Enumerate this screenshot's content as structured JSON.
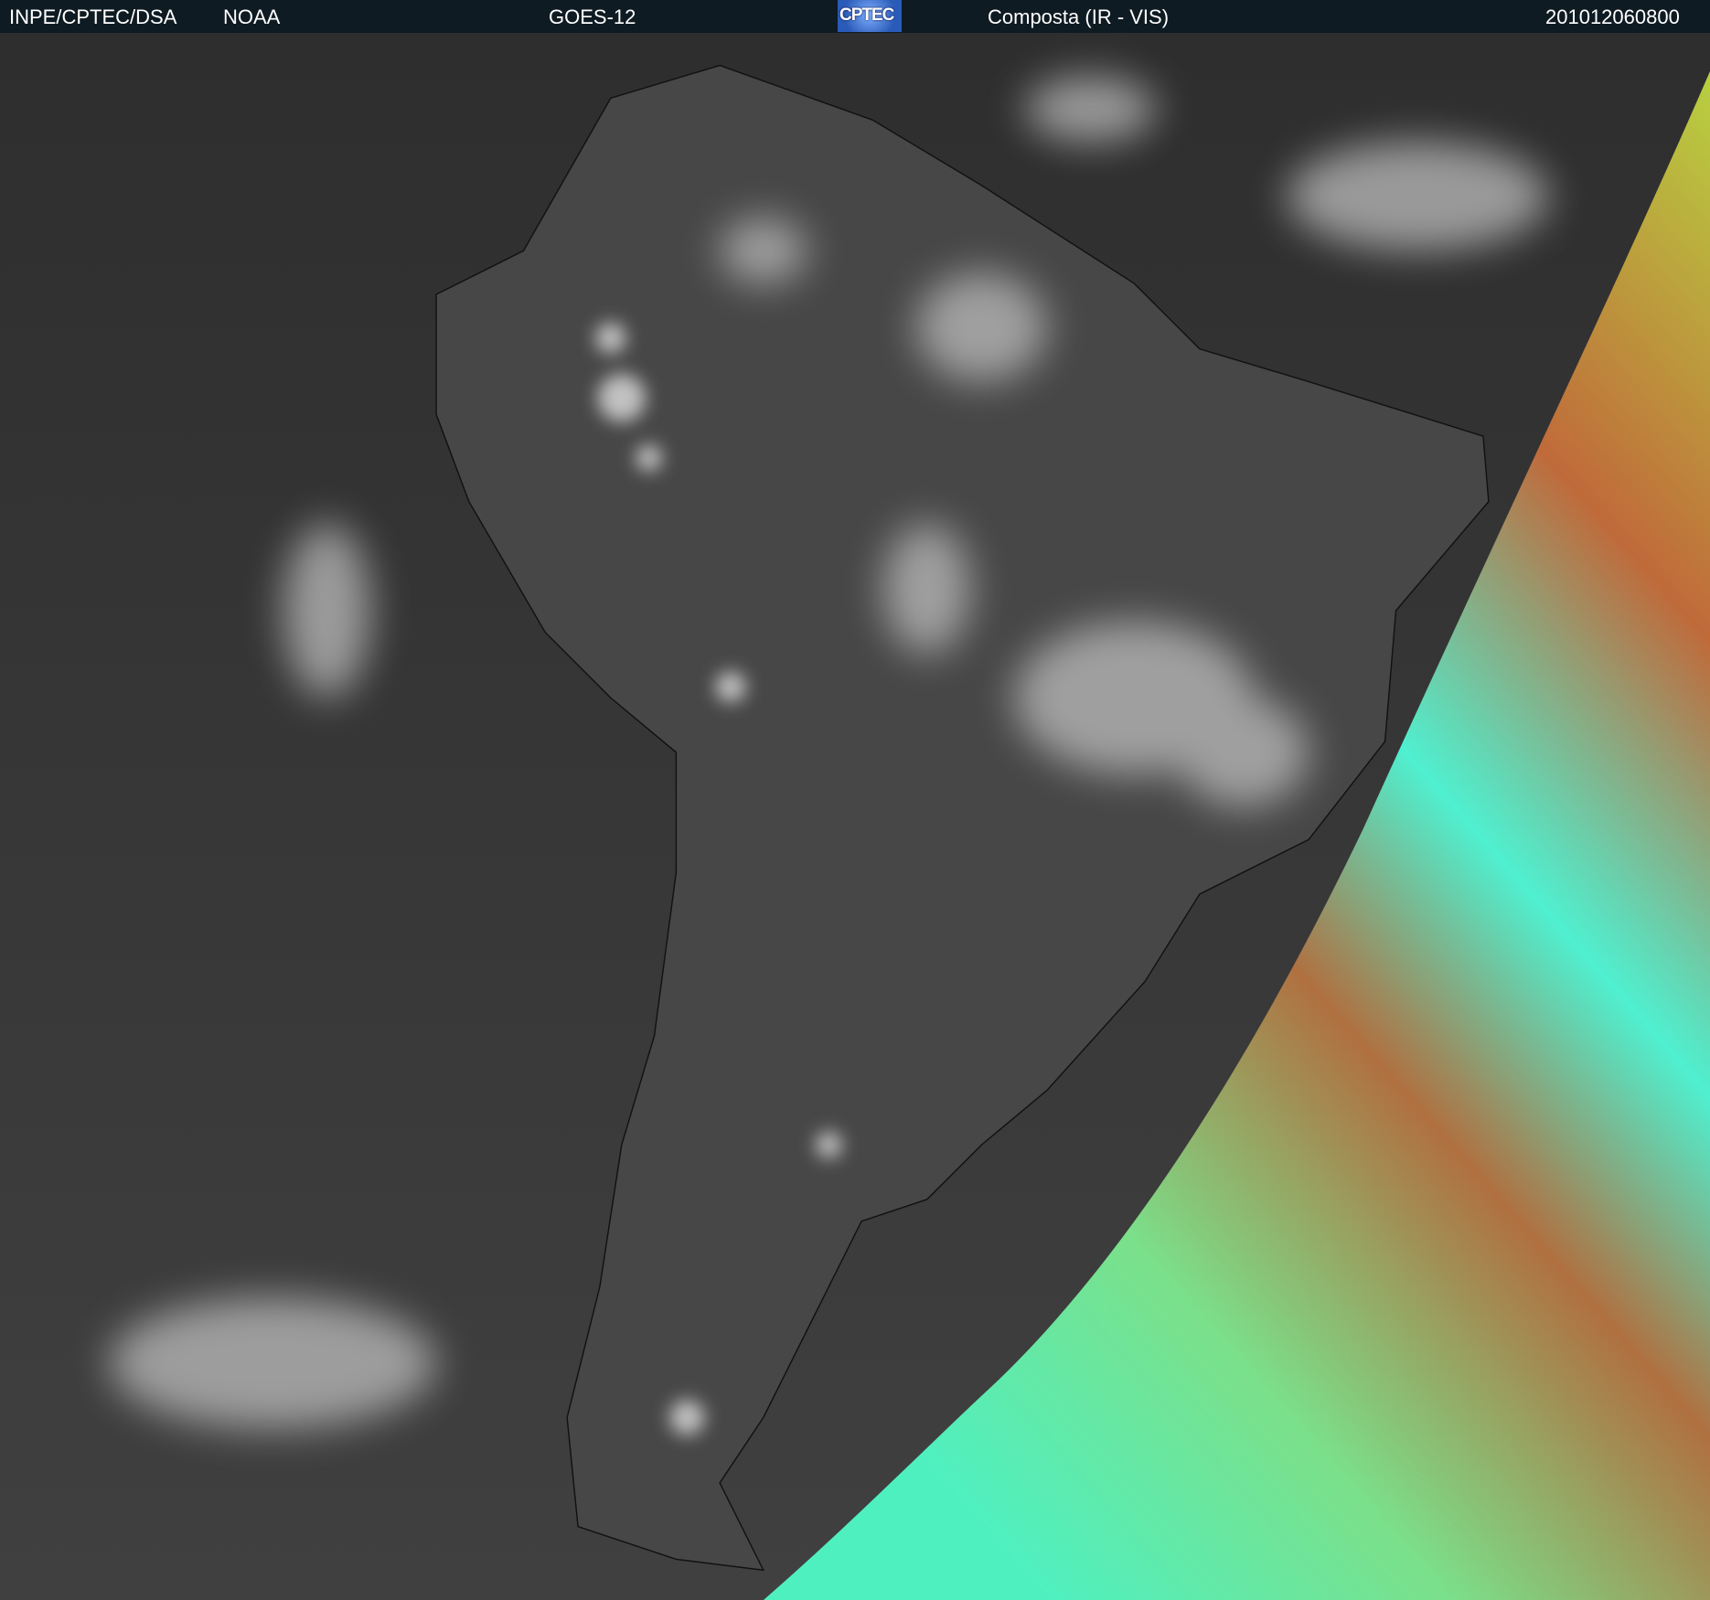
{
  "header": {
    "institution": "INPE/CPTEC/DSA",
    "agency": "NOAA",
    "satellite": "GOES-12",
    "logo_text": "CPTEC",
    "product": "Composta (IR - VIS)",
    "timestamp": "201012060800"
  },
  "colors": {
    "header_bg": "#0f1b23",
    "ocean_ir": "#3a3a3a",
    "vis_green": "#7be08a",
    "vis_cyan": "#4ff0d0",
    "vis_orange": "#c06a3a"
  }
}
